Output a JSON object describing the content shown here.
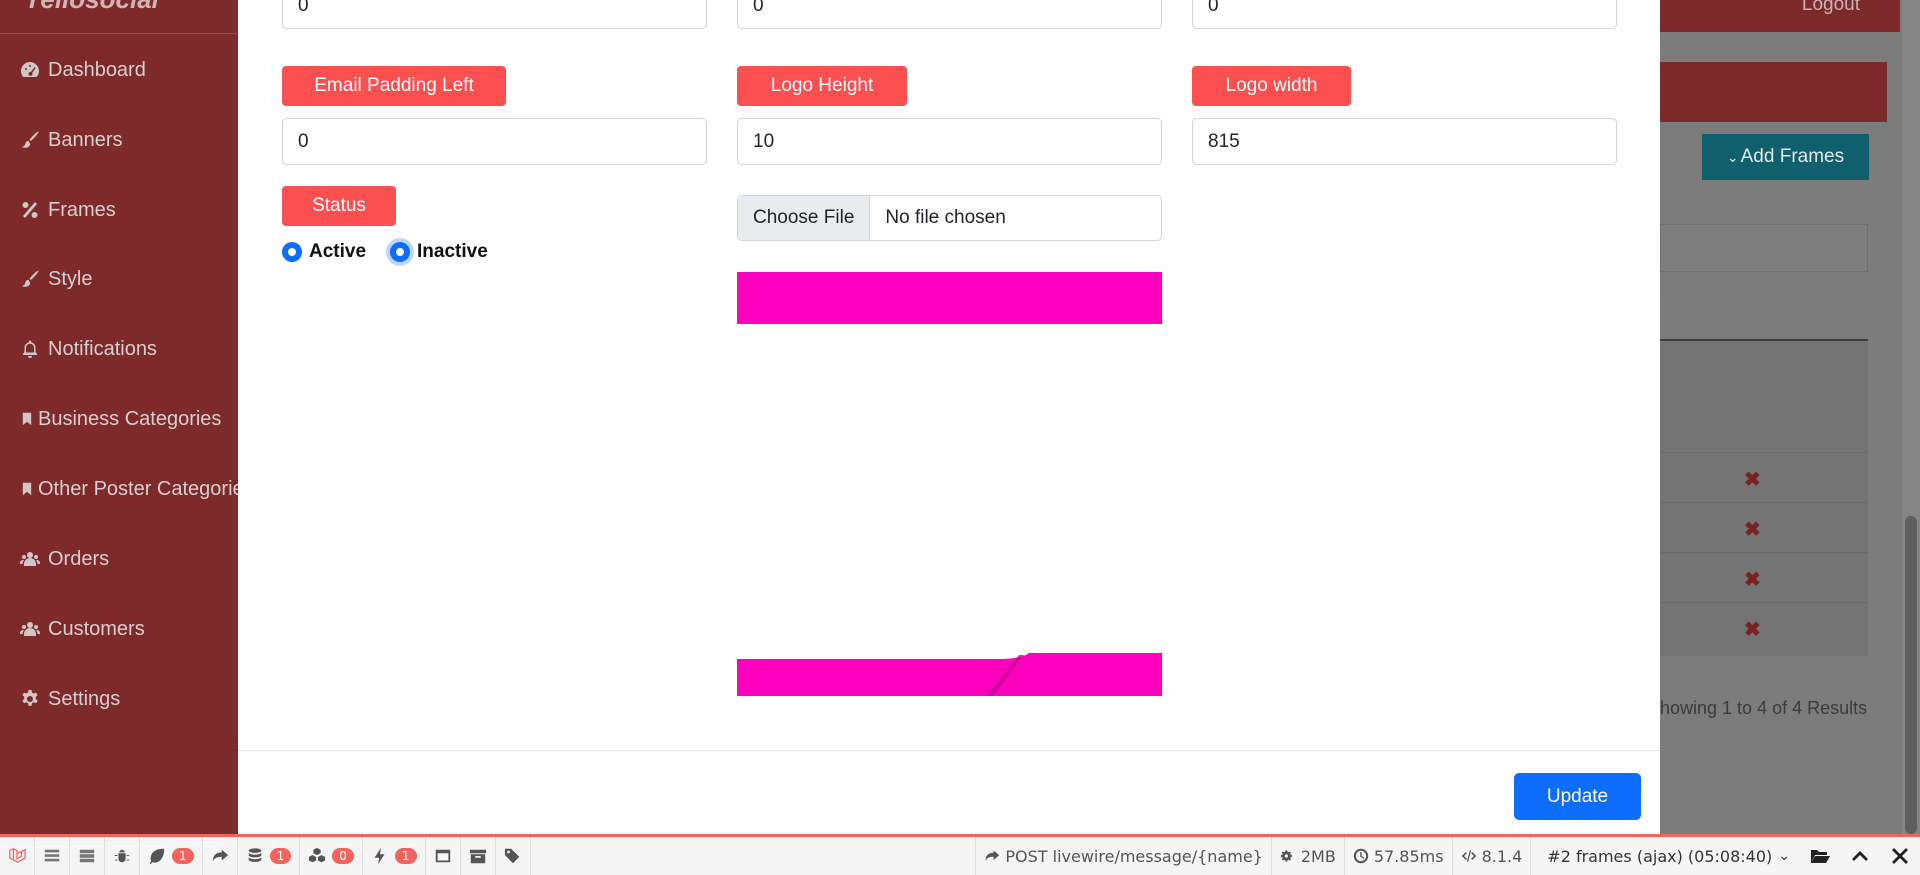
{
  "sidebar": {
    "brand": "Yellosocial",
    "items": [
      {
        "label": "Dashboard",
        "icon": "dashboard-icon"
      },
      {
        "label": "Banners",
        "icon": "brush-icon"
      },
      {
        "label": "Frames",
        "icon": "percent-icon"
      },
      {
        "label": "Style",
        "icon": "brush-icon"
      },
      {
        "label": "Notifications",
        "icon": "bell-icon"
      },
      {
        "label": "Business Categories",
        "icon": "bookmark-icon"
      },
      {
        "label": "Other Poster Categories",
        "icon": "bookmark-icon"
      },
      {
        "label": "Orders",
        "icon": "users-icon"
      },
      {
        "label": "Customers",
        "icon": "users-icon"
      },
      {
        "label": "Settings",
        "icon": "gear-icon"
      }
    ]
  },
  "background": {
    "logout_label": "Logout",
    "add_frames_label": "Add Frames",
    "showing_text": "howing 1 to 4 of 4 Results"
  },
  "modal": {
    "top_inputs": [
      "0",
      "0",
      "0"
    ],
    "email_padding_left": {
      "label": "Email Padding Left",
      "value": "0"
    },
    "logo_height": {
      "label": "Logo Height",
      "value": "10"
    },
    "logo_width": {
      "label": "Logo width",
      "value": "815"
    },
    "status": {
      "label": "Status",
      "options": [
        "Active",
        "Inactive"
      ]
    },
    "file": {
      "button": "Choose File",
      "text": "No file chosen"
    },
    "preview_color": "#ff00bf",
    "update_label": "Update"
  },
  "debugbar": {
    "badges": {
      "messages": "1",
      "queries": "1",
      "models": "0",
      "events": "1"
    },
    "route": "POST livewire/message/{name}",
    "memory": "2MB",
    "time": "57.85ms",
    "php_version": "8.1.4",
    "request_select": "#2 frames (ajax) (05:08:40)"
  },
  "colors": {
    "accent": "#fc5050",
    "primary": "#0d6efd",
    "sidebar": "#7e2a2b"
  }
}
